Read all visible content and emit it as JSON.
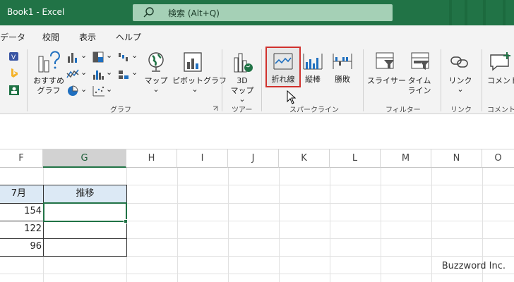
{
  "window": {
    "title": "Book1  -  Excel"
  },
  "search": {
    "text": "検索 (Alt+Q)"
  },
  "menu": {
    "tabs": [
      "データ",
      "校閲",
      "表示",
      "ヘルプ"
    ]
  },
  "ribbon": {
    "recommended_label_1": "おすすめ",
    "recommended_label_2": "グラフ",
    "map_label": "マップ",
    "pivot_label": "ピボットグラフ",
    "map3d_label_1": "3D",
    "map3d_label_2": "マップ",
    "line_label": "折れ線",
    "column_label": "縦棒",
    "winloss_label": "勝敗",
    "slicer_label": "スライサー",
    "timeline_label_1": "タイム",
    "timeline_label_2": "ライン",
    "link_label": "リンク",
    "comment_label": "コメント",
    "groups": {
      "chart": "グラフ",
      "tour": "ツアー",
      "sparklines": "スパークライン",
      "filter": "フィルター",
      "link": "リンク",
      "comment": "コメント"
    },
    "dropdown_glyph": "⌄"
  },
  "grid": {
    "columns": [
      "F",
      "G",
      "H",
      "I",
      "J",
      "K",
      "L",
      "M",
      "N",
      "O"
    ],
    "header_row": {
      "f": "7月",
      "g": "推移"
    },
    "values": [
      "154",
      "122",
      "96"
    ]
  },
  "watermark": "Buzzword Inc.",
  "colors": {
    "excel_green": "#217346",
    "highlight_red": "#d0312d",
    "header_fill": "#dce9f5"
  }
}
